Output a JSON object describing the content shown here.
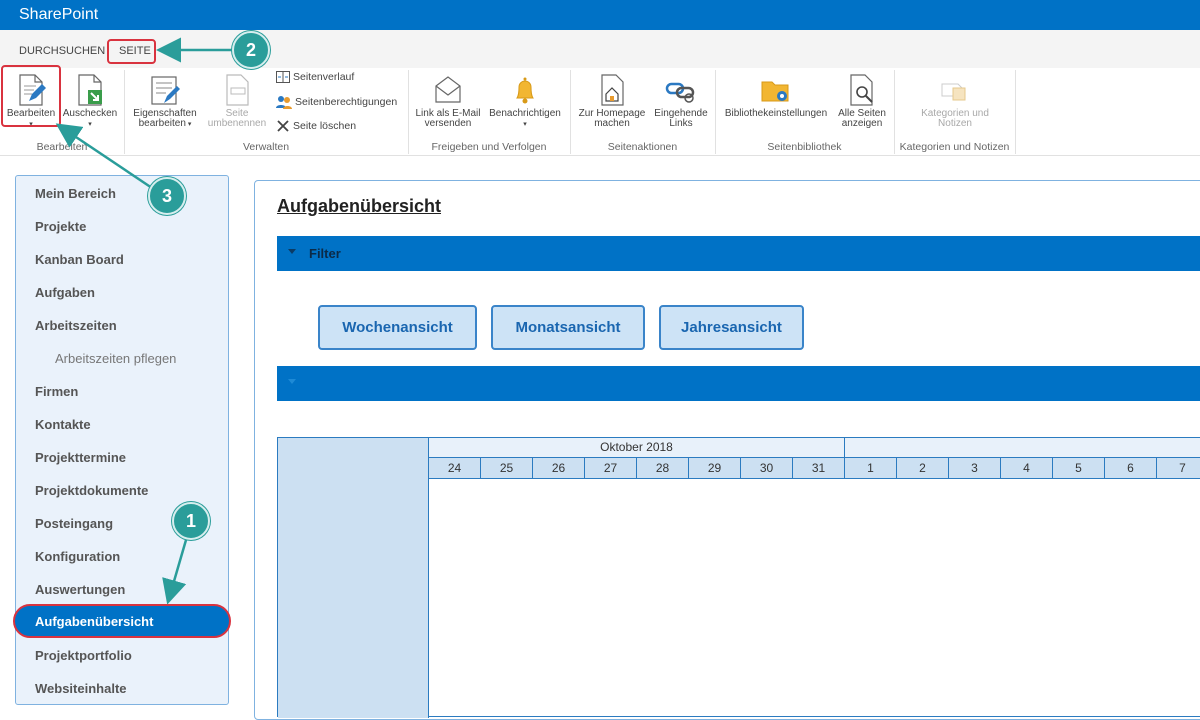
{
  "app": {
    "title": "SharePoint"
  },
  "tabs": [
    {
      "label": "DURCHSUCHEN"
    },
    {
      "label": "SEITE"
    }
  ],
  "ribbon": {
    "groups": {
      "bearbeiten": "Bearbeiten",
      "verwalten": "Verwalten",
      "freigeben": "Freigeben und Verfolgen",
      "seitenaktionen": "Seitenaktionen",
      "seitenbibliothek": "Seitenbibliothek",
      "kategorien": "Kategorien und Notizen"
    },
    "buttons": {
      "bearbeiten": "Bearbeiten",
      "auschecken": "Auschecken",
      "eigenschaften_1": "Eigenschaften",
      "eigenschaften_2": "bearbeiten",
      "umbenennen_1": "Seite",
      "umbenennen_2": "umbenennen",
      "seitenverlauf": "Seitenverlauf",
      "seitenberechtigungen": "Seitenberechtigungen",
      "seite_loeschen": "Seite löschen",
      "email_1": "Link als E-Mail",
      "email_2": "versenden",
      "benachrichtigen": "Benachrichtigen",
      "homepage_1": "Zur Homepage",
      "homepage_2": "machen",
      "eingehende_1": "Eingehende",
      "eingehende_2": "Links",
      "bibliothek": "Bibliothekeinstellungen",
      "alle_seiten_1": "Alle Seiten",
      "alle_seiten_2": "anzeigen",
      "kategorien_1": "Kategorien und",
      "kategorien_2": "Notizen"
    }
  },
  "nav": {
    "items": [
      "Mein Bereich",
      "Projekte",
      "Kanban Board",
      "Aufgaben",
      "Arbeitszeiten",
      "Arbeitszeiten pflegen",
      "Firmen",
      "Kontakte",
      "Projekttermine",
      "Projektdokumente",
      "Posteingang",
      "Konfiguration",
      "Auswertungen",
      "Aufgabenübersicht",
      "Projektportfolio",
      "Websiteinhalte"
    ],
    "active_index": 13
  },
  "main": {
    "title": "Aufgabenübersicht",
    "filter_label": "Filter",
    "views": [
      "Wochenansicht",
      "Monatsansicht",
      "Jahresansicht"
    ],
    "timeline": {
      "month_label": "Oktober 2018",
      "days": [
        "24",
        "25",
        "26",
        "27",
        "28",
        "29",
        "30",
        "31",
        "1",
        "2",
        "3",
        "4",
        "5",
        "6",
        "7"
      ]
    }
  },
  "callouts": [
    "1",
    "2",
    "3"
  ],
  "colors": {
    "brand": "#0072c6",
    "highlight": "#d9333f",
    "callout": "#2a9d9a",
    "nav_bg": "#eaf2fb"
  }
}
